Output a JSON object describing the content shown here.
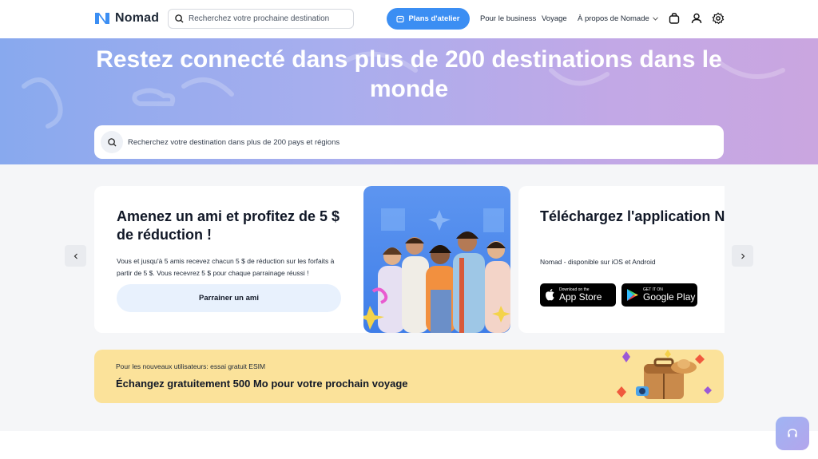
{
  "header": {
    "brand": "Nomad",
    "search_placeholder": "Recherchez votre prochaine destination",
    "plans_label": "Plans d'atelier",
    "nav": {
      "business": "Pour le business",
      "voyage": "Voyage",
      "about": "À propos de Nomade"
    },
    "icons": [
      "logo-icon",
      "search-icon",
      "plans-icon",
      "chevron-down-icon",
      "bag-icon",
      "user-icon",
      "gear-icon"
    ]
  },
  "hero": {
    "title": "Restez connecté dans plus de 200 destinations dans le monde",
    "search_placeholder": "Recherchez votre destination dans plus de 200 pays et régions"
  },
  "referral": {
    "title": "Amenez un ami et profitez de 5 $ de réduction !",
    "text": "Vous et jusqu'à 5 amis recevez chacun 5 $ de réduction sur les forfaits à partir de 5 $. Vous recevrez 5 $ pour chaque parrainage réussi !",
    "button": "Parrainer un ami"
  },
  "app_card": {
    "title": "Téléchargez l'application No",
    "subtitle": "Nomad - disponible sur iOS et Android",
    "appstore_small": "Download on the",
    "appstore_big": "App Store",
    "gplay_small": "GET IT ON",
    "gplay_big": "Google Play"
  },
  "promo": {
    "small": "Pour les nouveaux utilisateurs: essai gratuit ESIM",
    "big": "Échangez gratuitement 500 Mo pour votre prochain voyage"
  },
  "colors": {
    "primary": "#3b8ef3",
    "promo_bg": "#fbe29a",
    "hero_start": "#88a9ee",
    "hero_end": "#caa6e0"
  }
}
